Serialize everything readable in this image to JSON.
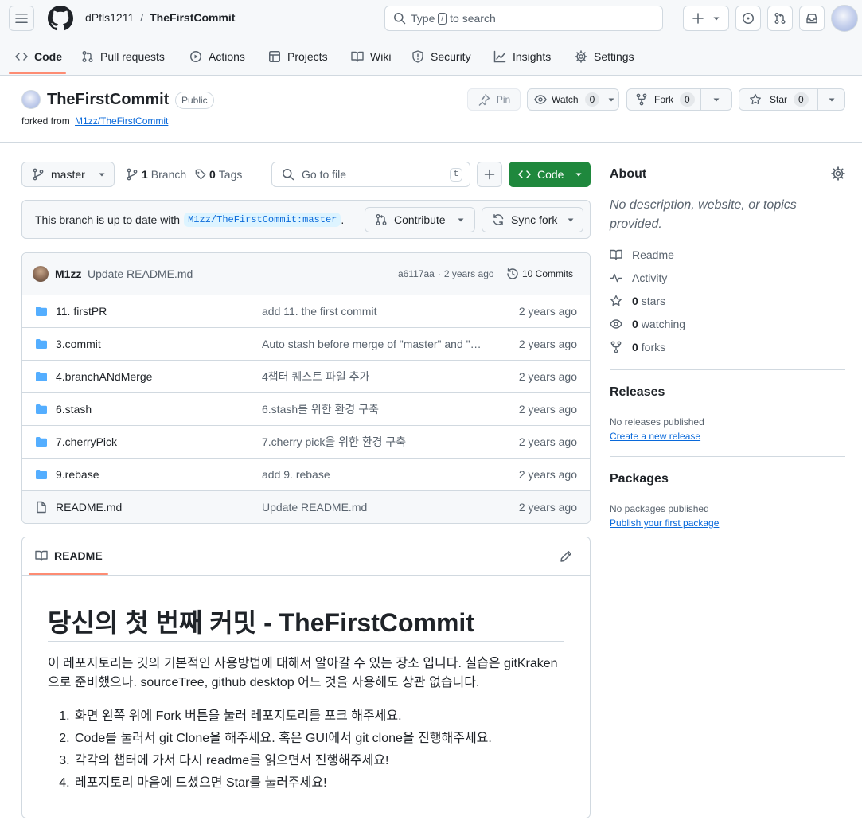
{
  "header": {
    "owner": "dPfls1211",
    "separator": "/",
    "repo": "TheFirstCommit",
    "search_pre": "Type",
    "search_key": "/",
    "search_post": "to search"
  },
  "nav": {
    "tabs": [
      {
        "label": "Code"
      },
      {
        "label": "Pull requests"
      },
      {
        "label": "Actions"
      },
      {
        "label": "Projects"
      },
      {
        "label": "Wiki"
      },
      {
        "label": "Security"
      },
      {
        "label": "Insights"
      },
      {
        "label": "Settings"
      }
    ]
  },
  "repo": {
    "name": "TheFirstCommit",
    "visibility": "Public",
    "forked_from_label": "forked from",
    "forked_from": "M1zz/TheFirstCommit",
    "pin": "Pin",
    "watch": "Watch",
    "watch_count": "0",
    "fork": "Fork",
    "fork_count": "0",
    "star": "Star",
    "star_count": "0"
  },
  "toolbar": {
    "branch": "master",
    "branch_count": "1",
    "branch_label": "Branch",
    "tag_count": "0",
    "tag_label": "Tags",
    "goto_placeholder": "Go to file",
    "goto_key": "t",
    "code_button": "Code"
  },
  "sync": {
    "text": "This branch is up to date with",
    "ref": "M1zz/TheFirstCommit:master",
    "period": ".",
    "contribute": "Contribute",
    "sync_fork": "Sync fork"
  },
  "commit": {
    "author": "M1zz",
    "message": "Update README.md",
    "sha": "a6117aa",
    "dot": "·",
    "age": "2 years ago",
    "commits_label": "10 Commits"
  },
  "files": [
    {
      "name": "11. firstPR",
      "msg": "add 11. the first commit",
      "age": "2 years ago",
      "type": "dir"
    },
    {
      "name": "3.commit",
      "msg": "Auto stash before merge of \"master\" and \"origin/master\"",
      "age": "2 years ago",
      "type": "dir"
    },
    {
      "name": "4.branchANdMerge",
      "msg": "4챕터 퀘스트 파일 추가",
      "age": "2 years ago",
      "type": "dir"
    },
    {
      "name": "6.stash",
      "msg": "6.stash를 위한 환경 구축",
      "age": "2 years ago",
      "type": "dir"
    },
    {
      "name": "7.cherryPick",
      "msg": "7.cherry pick을 위한 환경 구축",
      "age": "2 years ago",
      "type": "dir"
    },
    {
      "name": "9.rebase",
      "msg": "add 9. rebase",
      "age": "2 years ago",
      "type": "dir"
    },
    {
      "name": "README.md",
      "msg": "Update README.md",
      "age": "2 years ago",
      "type": "file"
    }
  ],
  "readme": {
    "tab": "README",
    "title": "당신의 첫 번째 커밋 - TheFirstCommit",
    "intro": "이 레포지토리는 깃의 기본적인 사용방법에 대해서 알아갈 수 있는 장소 입니다. 실습은 gitKraken으로 준비했으나. sourceTree, github desktop 어느 것을 사용해도 상관 없습니다.",
    "steps": [
      "화면 왼쪽 위에 Fork 버튼을 눌러 레포지토리를 포크 해주세요.",
      "Code를 눌러서 git Clone을 해주세요. 혹은 GUI에서 git clone을 진행해주세요.",
      "각각의 챕터에 가서 다시 readme를 읽으면서 진행해주세요!",
      "레포지토리 마음에 드셨으면 Star를 눌러주세요!"
    ]
  },
  "about": {
    "title": "About",
    "description": "No description, website, or topics provided.",
    "readme": "Readme",
    "activity": "Activity",
    "stars_count": "0",
    "stars_label": "stars",
    "watching_count": "0",
    "watching_label": "watching",
    "forks_count": "0",
    "forks_label": "forks"
  },
  "releases": {
    "title": "Releases",
    "empty": "No releases published",
    "link": "Create a new release"
  },
  "packages": {
    "title": "Packages",
    "empty": "No packages published",
    "link": "Publish your first package"
  },
  "colors": {
    "accent": "#0969da",
    "green": "#1f883d",
    "tab_underline": "#fd8c73",
    "folder": "#54aeff"
  }
}
